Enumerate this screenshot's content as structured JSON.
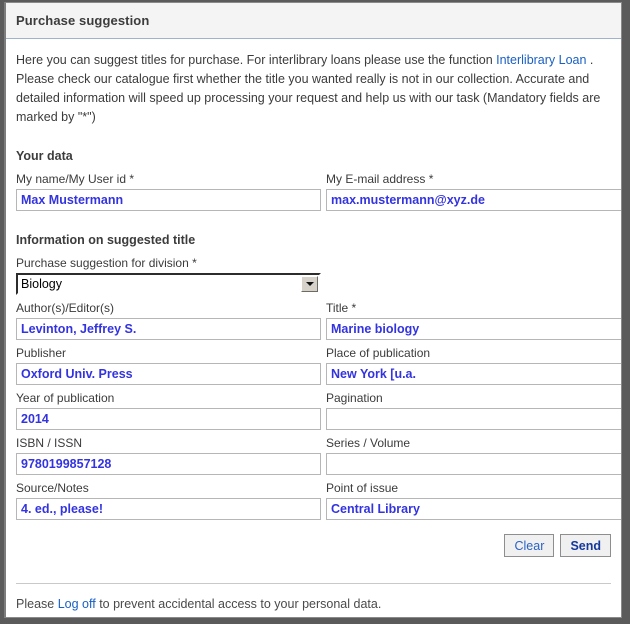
{
  "window": {
    "title": "Purchase suggestion"
  },
  "intro": {
    "line1_before": "Here you can suggest titles for purchase. For interlibrary loans please use the function ",
    "link_label": "Interlibrary Loan",
    "line1_after": " .",
    "line2": "Please check our catalogue first whether the title you wanted really is not in our collection. Accurate and detailed information will speed up processing your request and help us with our task (Mandatory fields are marked by \"*\")"
  },
  "sections": {
    "your_data": "Your data",
    "suggested_title": "Information on suggested title"
  },
  "fields": {
    "name": {
      "label": "My name/My User id *",
      "value": "Max Mustermann",
      "placeholder": ""
    },
    "email": {
      "label": "My E-mail address *",
      "value": "max.mustermann@xyz.de",
      "placeholder": ""
    },
    "division": {
      "label": "Purchase suggestion for division *",
      "value": "Biology",
      "options": [
        "Biology"
      ]
    },
    "authors": {
      "label": "Author(s)/Editor(s)",
      "value": "Levinton, Jeffrey S.",
      "placeholder": ""
    },
    "title": {
      "label": "Title *",
      "value": "Marine biology",
      "placeholder": ""
    },
    "publisher": {
      "label": "Publisher",
      "value": "Oxford Univ. Press",
      "placeholder": ""
    },
    "place": {
      "label": "Place of publication",
      "value": "New York [u.a.",
      "placeholder": ""
    },
    "year": {
      "label": "Year of publication",
      "value": "2014",
      "placeholder": ""
    },
    "pagination": {
      "label": "Pagination",
      "value": "",
      "placeholder": ""
    },
    "isbn": {
      "label": "ISBN / ISSN",
      "value": "9780199857128",
      "placeholder": ""
    },
    "series": {
      "label": "Series / Volume",
      "value": "",
      "placeholder": ""
    },
    "source": {
      "label": "Source/Notes",
      "value": "4. ed., please!",
      "placeholder": ""
    },
    "point_of_issue": {
      "label": "Point of issue",
      "value": "Central Library",
      "placeholder": ""
    }
  },
  "buttons": {
    "clear": "Clear",
    "send": "Send"
  },
  "footer": {
    "before": "Please ",
    "link_label": "Log off",
    "after": " to prevent accidental access to your personal data."
  },
  "colors": {
    "input_value": "#3333e0",
    "link": "#1a5fc4",
    "heading": "#3c3c3c",
    "page_background": "#5b5b5b"
  }
}
